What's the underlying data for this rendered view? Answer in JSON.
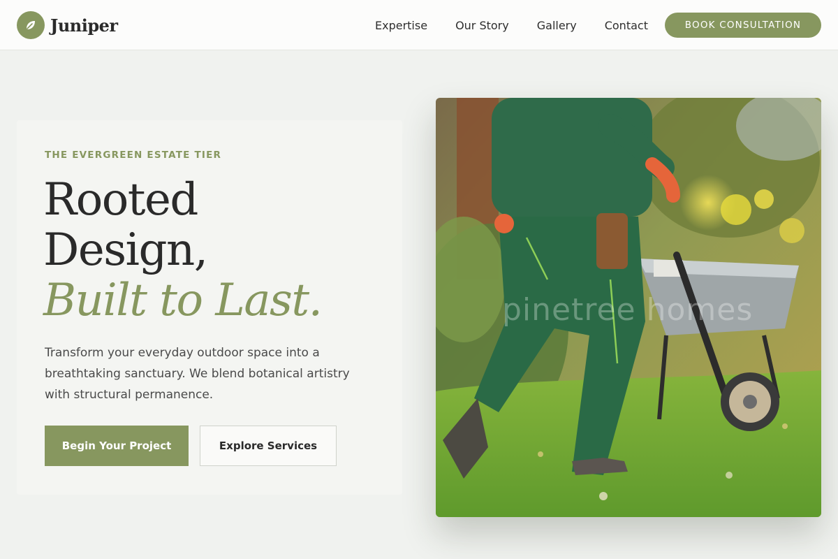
{
  "header": {
    "brand": {
      "name": "Juniper",
      "icon": "leaf-icon"
    },
    "nav": [
      {
        "label": "Expertise"
      },
      {
        "label": "Our Story"
      },
      {
        "label": "Gallery"
      },
      {
        "label": "Contact"
      }
    ],
    "cta_label": "BOOK CONSULTATION"
  },
  "hero": {
    "eyebrow": "THE EVERGREEN ESTATE TIER",
    "headline_line1": "Rooted",
    "headline_line2": "Design,",
    "headline_accent": "Built to Last.",
    "description": "Transform your everyday outdoor space into a breathtaking sanctuary. We blend botanical artistry with structural permanence.",
    "primary_button": "Begin Your Project",
    "secondary_button": "Explore Services"
  },
  "image": {
    "watermark": "pinetree homes"
  },
  "colors": {
    "accent": "#87975f",
    "page_background": "#f0f2ef",
    "header_background": "#fcfcfb",
    "text_dark": "#2a2a2a"
  }
}
